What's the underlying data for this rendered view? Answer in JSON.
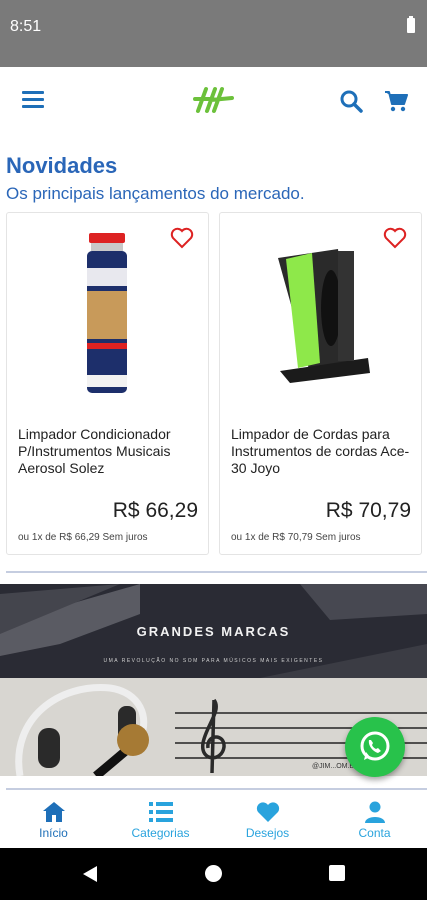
{
  "status_bar": {
    "time": "8:51"
  },
  "header": {
    "menu_icon": "hamburger-menu-icon",
    "logo_icon": "store-logo-icon",
    "search_icon": "search-icon",
    "cart_icon": "cart-icon"
  },
  "section": {
    "title": "Novidades",
    "subtitle": "Os principais lançamentos do mercado."
  },
  "products": [
    {
      "name": "Limpador Condicionador P/Instrumentos Musicais Aerosol Solez",
      "price": "R$ 66,29",
      "installment": "ou 1x de R$ 66,29 Sem juros"
    },
    {
      "name": "Limpador de Cordas para Instrumentos de cordas Ace-30 Joyo",
      "price": "R$ 70,79",
      "installment": "ou 1x de R$ 70,79 Sem juros"
    }
  ],
  "banner_brands": {
    "headline": "GRANDES MARCAS",
    "tagline": "UMA REVOLUÇÃO NO SOM PARA MÚSICOS MAIS EXIGENTES"
  },
  "banner_music": {
    "handle": "@JIM...OM.BR"
  },
  "bottom_nav": [
    {
      "label": "Início",
      "icon": "home-icon"
    },
    {
      "label": "Categorias",
      "icon": "list-icon"
    },
    {
      "label": "Desejos",
      "icon": "heart-icon"
    },
    {
      "label": "Conta",
      "icon": "user-icon"
    }
  ],
  "colors": {
    "primary_blue": "#2a66b8",
    "nav_blue": "#29a3dd",
    "whatsapp_green": "#28c24b",
    "logo_green": "#6cc13b"
  }
}
